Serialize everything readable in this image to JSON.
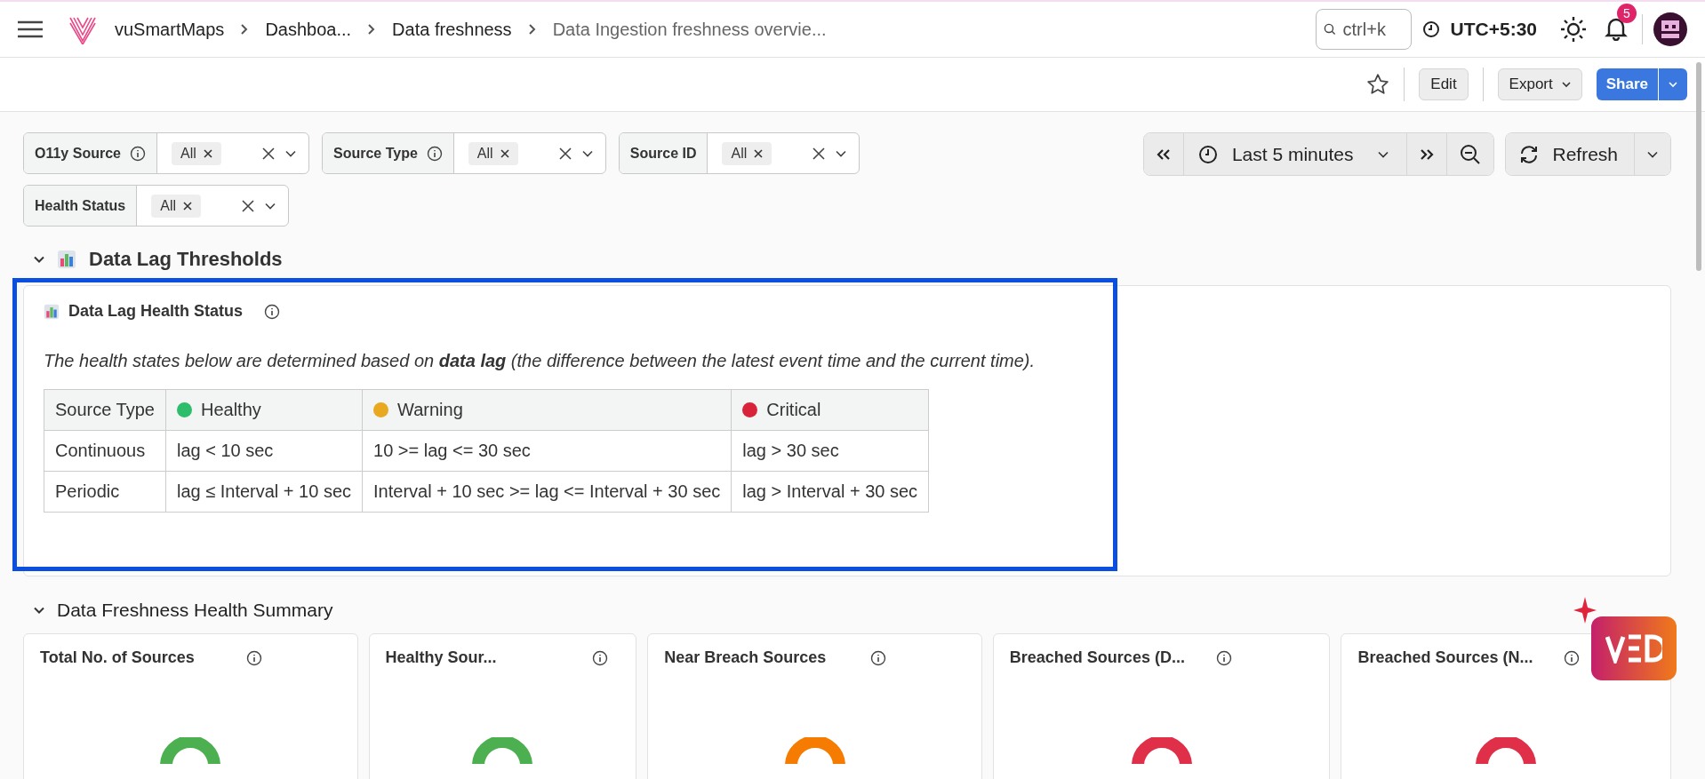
{
  "breadcrumb": [
    "vuSmartMaps",
    "Dashboa...",
    "Data freshness",
    "Data Ingestion freshness overvie..."
  ],
  "search": {
    "placeholder": "ctrl+k"
  },
  "timezone": "UTC+5:30",
  "notifications": {
    "count": "5"
  },
  "toolbar": {
    "edit": "Edit",
    "export": "Export",
    "share": "Share"
  },
  "filters": [
    {
      "label": "O11y Source",
      "info": true,
      "chip": "All"
    },
    {
      "label": "Source Type",
      "info": true,
      "chip": "All"
    },
    {
      "label": "Source ID",
      "info": false,
      "chip": "All"
    },
    {
      "label": "Health Status",
      "info": false,
      "chip": "All"
    }
  ],
  "time_range": {
    "label": "Last 5 minutes"
  },
  "refresh": {
    "label": "Refresh"
  },
  "sections": [
    {
      "title": "Data Lag Thresholds",
      "expanded": true
    },
    {
      "title": "Data Freshness Health Summary",
      "expanded": true
    }
  ],
  "panel": {
    "title": "Data Lag Health Status",
    "description": "The health states below are determined based on **data lag** (the difference between the latest event time and the current time).",
    "columns": [
      {
        "label": "Source Type"
      },
      {
        "label": "Healthy",
        "color": "#2ebd6b"
      },
      {
        "label": "Warning",
        "color": "#e8a820"
      },
      {
        "label": "Critical",
        "color": "#d9233a"
      }
    ],
    "rows": [
      [
        "Continuous",
        "lag < 10 sec",
        "10 >= lag <= 30 sec",
        "lag > 30 sec"
      ],
      [
        "Periodic",
        "lag ≤ Interval + 10 sec",
        "Interval + 10 sec >= lag <= Interval + 30 sec",
        "lag > Interval + 30 sec"
      ]
    ]
  },
  "summary_cards": [
    {
      "title": "Total No. of Sources",
      "color": "#4caf50"
    },
    {
      "title": "Healthy Sour...",
      "color": "#4caf50"
    },
    {
      "title": "Near Breach Sources",
      "color": "#f57c00"
    },
    {
      "title": "Breached Sources (D...",
      "color": "#e02f48"
    },
    {
      "title": "Breached Sources (N...",
      "color": "#e02f48"
    }
  ]
}
